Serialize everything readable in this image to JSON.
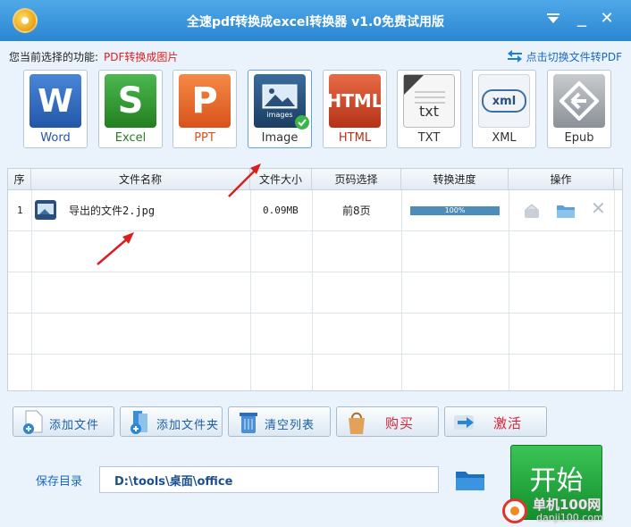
{
  "window": {
    "title": "全速pdf转换成excel转换器 v1.0免费试用版"
  },
  "function_bar": {
    "label": "您当前选择的功能:",
    "value": "PDF转换成图片",
    "switch_link": "点击切换文件转PDF"
  },
  "formats": [
    {
      "label": "Word",
      "glyph": "W",
      "color": "#2f6cc4"
    },
    {
      "label": "Excel",
      "glyph": "S",
      "color": "#2e9a34"
    },
    {
      "label": "PPT",
      "glyph": "P",
      "color": "#e5682a"
    },
    {
      "label": "Image",
      "glyph": "images",
      "color": "#234a74"
    },
    {
      "label": "HTML",
      "glyph": "HTML",
      "color": "#cf4a2a"
    },
    {
      "label": "TXT",
      "glyph": "txt",
      "color": "#f2f2f2"
    },
    {
      "label": "XML",
      "glyph": "xml",
      "color": "#e8eef5"
    },
    {
      "label": "Epub",
      "glyph": "e",
      "color": "#9aa0a6"
    }
  ],
  "table": {
    "headers": [
      "序",
      "文件名称",
      "文件大小",
      "页码选择",
      "转换进度",
      "操作"
    ],
    "rows": [
      {
        "index": "1",
        "name": "导出的文件2.jpg",
        "size": "0.09MB",
        "pages": "前8页",
        "progress": 100,
        "progress_text": "100%"
      }
    ]
  },
  "buttons": {
    "add_file": "添加文件",
    "add_folder": "添加文件夹",
    "clear_list": "清空列表",
    "buy": "购买",
    "activate": "激活",
    "start": "开始"
  },
  "save": {
    "label": "保存目录",
    "path": "D:\\tools\\桌面\\office"
  },
  "watermark": {
    "text": "单机100网",
    "sub": "danji100.com"
  }
}
